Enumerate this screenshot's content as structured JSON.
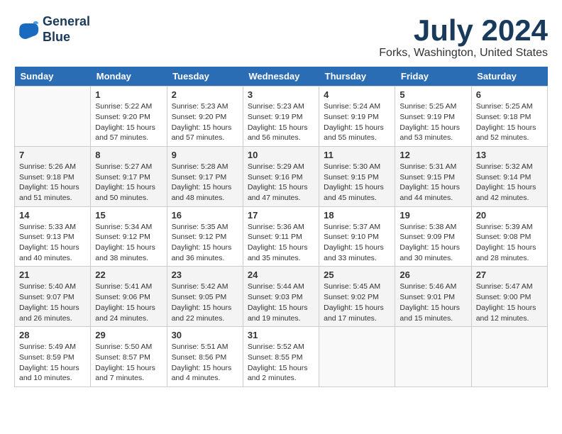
{
  "header": {
    "logo_line1": "General",
    "logo_line2": "Blue",
    "month": "July 2024",
    "location": "Forks, Washington, United States"
  },
  "weekdays": [
    "Sunday",
    "Monday",
    "Tuesday",
    "Wednesday",
    "Thursday",
    "Friday",
    "Saturday"
  ],
  "weeks": [
    [
      {
        "num": "",
        "info": ""
      },
      {
        "num": "1",
        "info": "Sunrise: 5:22 AM\nSunset: 9:20 PM\nDaylight: 15 hours\nand 57 minutes."
      },
      {
        "num": "2",
        "info": "Sunrise: 5:23 AM\nSunset: 9:20 PM\nDaylight: 15 hours\nand 57 minutes."
      },
      {
        "num": "3",
        "info": "Sunrise: 5:23 AM\nSunset: 9:19 PM\nDaylight: 15 hours\nand 56 minutes."
      },
      {
        "num": "4",
        "info": "Sunrise: 5:24 AM\nSunset: 9:19 PM\nDaylight: 15 hours\nand 55 minutes."
      },
      {
        "num": "5",
        "info": "Sunrise: 5:25 AM\nSunset: 9:19 PM\nDaylight: 15 hours\nand 53 minutes."
      },
      {
        "num": "6",
        "info": "Sunrise: 5:25 AM\nSunset: 9:18 PM\nDaylight: 15 hours\nand 52 minutes."
      }
    ],
    [
      {
        "num": "7",
        "info": "Sunrise: 5:26 AM\nSunset: 9:18 PM\nDaylight: 15 hours\nand 51 minutes."
      },
      {
        "num": "8",
        "info": "Sunrise: 5:27 AM\nSunset: 9:17 PM\nDaylight: 15 hours\nand 50 minutes."
      },
      {
        "num": "9",
        "info": "Sunrise: 5:28 AM\nSunset: 9:17 PM\nDaylight: 15 hours\nand 48 minutes."
      },
      {
        "num": "10",
        "info": "Sunrise: 5:29 AM\nSunset: 9:16 PM\nDaylight: 15 hours\nand 47 minutes."
      },
      {
        "num": "11",
        "info": "Sunrise: 5:30 AM\nSunset: 9:15 PM\nDaylight: 15 hours\nand 45 minutes."
      },
      {
        "num": "12",
        "info": "Sunrise: 5:31 AM\nSunset: 9:15 PM\nDaylight: 15 hours\nand 44 minutes."
      },
      {
        "num": "13",
        "info": "Sunrise: 5:32 AM\nSunset: 9:14 PM\nDaylight: 15 hours\nand 42 minutes."
      }
    ],
    [
      {
        "num": "14",
        "info": "Sunrise: 5:33 AM\nSunset: 9:13 PM\nDaylight: 15 hours\nand 40 minutes."
      },
      {
        "num": "15",
        "info": "Sunrise: 5:34 AM\nSunset: 9:12 PM\nDaylight: 15 hours\nand 38 minutes."
      },
      {
        "num": "16",
        "info": "Sunrise: 5:35 AM\nSunset: 9:12 PM\nDaylight: 15 hours\nand 36 minutes."
      },
      {
        "num": "17",
        "info": "Sunrise: 5:36 AM\nSunset: 9:11 PM\nDaylight: 15 hours\nand 35 minutes."
      },
      {
        "num": "18",
        "info": "Sunrise: 5:37 AM\nSunset: 9:10 PM\nDaylight: 15 hours\nand 33 minutes."
      },
      {
        "num": "19",
        "info": "Sunrise: 5:38 AM\nSunset: 9:09 PM\nDaylight: 15 hours\nand 30 minutes."
      },
      {
        "num": "20",
        "info": "Sunrise: 5:39 AM\nSunset: 9:08 PM\nDaylight: 15 hours\nand 28 minutes."
      }
    ],
    [
      {
        "num": "21",
        "info": "Sunrise: 5:40 AM\nSunset: 9:07 PM\nDaylight: 15 hours\nand 26 minutes."
      },
      {
        "num": "22",
        "info": "Sunrise: 5:41 AM\nSunset: 9:06 PM\nDaylight: 15 hours\nand 24 minutes."
      },
      {
        "num": "23",
        "info": "Sunrise: 5:42 AM\nSunset: 9:05 PM\nDaylight: 15 hours\nand 22 minutes."
      },
      {
        "num": "24",
        "info": "Sunrise: 5:44 AM\nSunset: 9:03 PM\nDaylight: 15 hours\nand 19 minutes."
      },
      {
        "num": "25",
        "info": "Sunrise: 5:45 AM\nSunset: 9:02 PM\nDaylight: 15 hours\nand 17 minutes."
      },
      {
        "num": "26",
        "info": "Sunrise: 5:46 AM\nSunset: 9:01 PM\nDaylight: 15 hours\nand 15 minutes."
      },
      {
        "num": "27",
        "info": "Sunrise: 5:47 AM\nSunset: 9:00 PM\nDaylight: 15 hours\nand 12 minutes."
      }
    ],
    [
      {
        "num": "28",
        "info": "Sunrise: 5:49 AM\nSunset: 8:59 PM\nDaylight: 15 hours\nand 10 minutes."
      },
      {
        "num": "29",
        "info": "Sunrise: 5:50 AM\nSunset: 8:57 PM\nDaylight: 15 hours\nand 7 minutes."
      },
      {
        "num": "30",
        "info": "Sunrise: 5:51 AM\nSunset: 8:56 PM\nDaylight: 15 hours\nand 4 minutes."
      },
      {
        "num": "31",
        "info": "Sunrise: 5:52 AM\nSunset: 8:55 PM\nDaylight: 15 hours\nand 2 minutes."
      },
      {
        "num": "",
        "info": ""
      },
      {
        "num": "",
        "info": ""
      },
      {
        "num": "",
        "info": ""
      }
    ]
  ]
}
